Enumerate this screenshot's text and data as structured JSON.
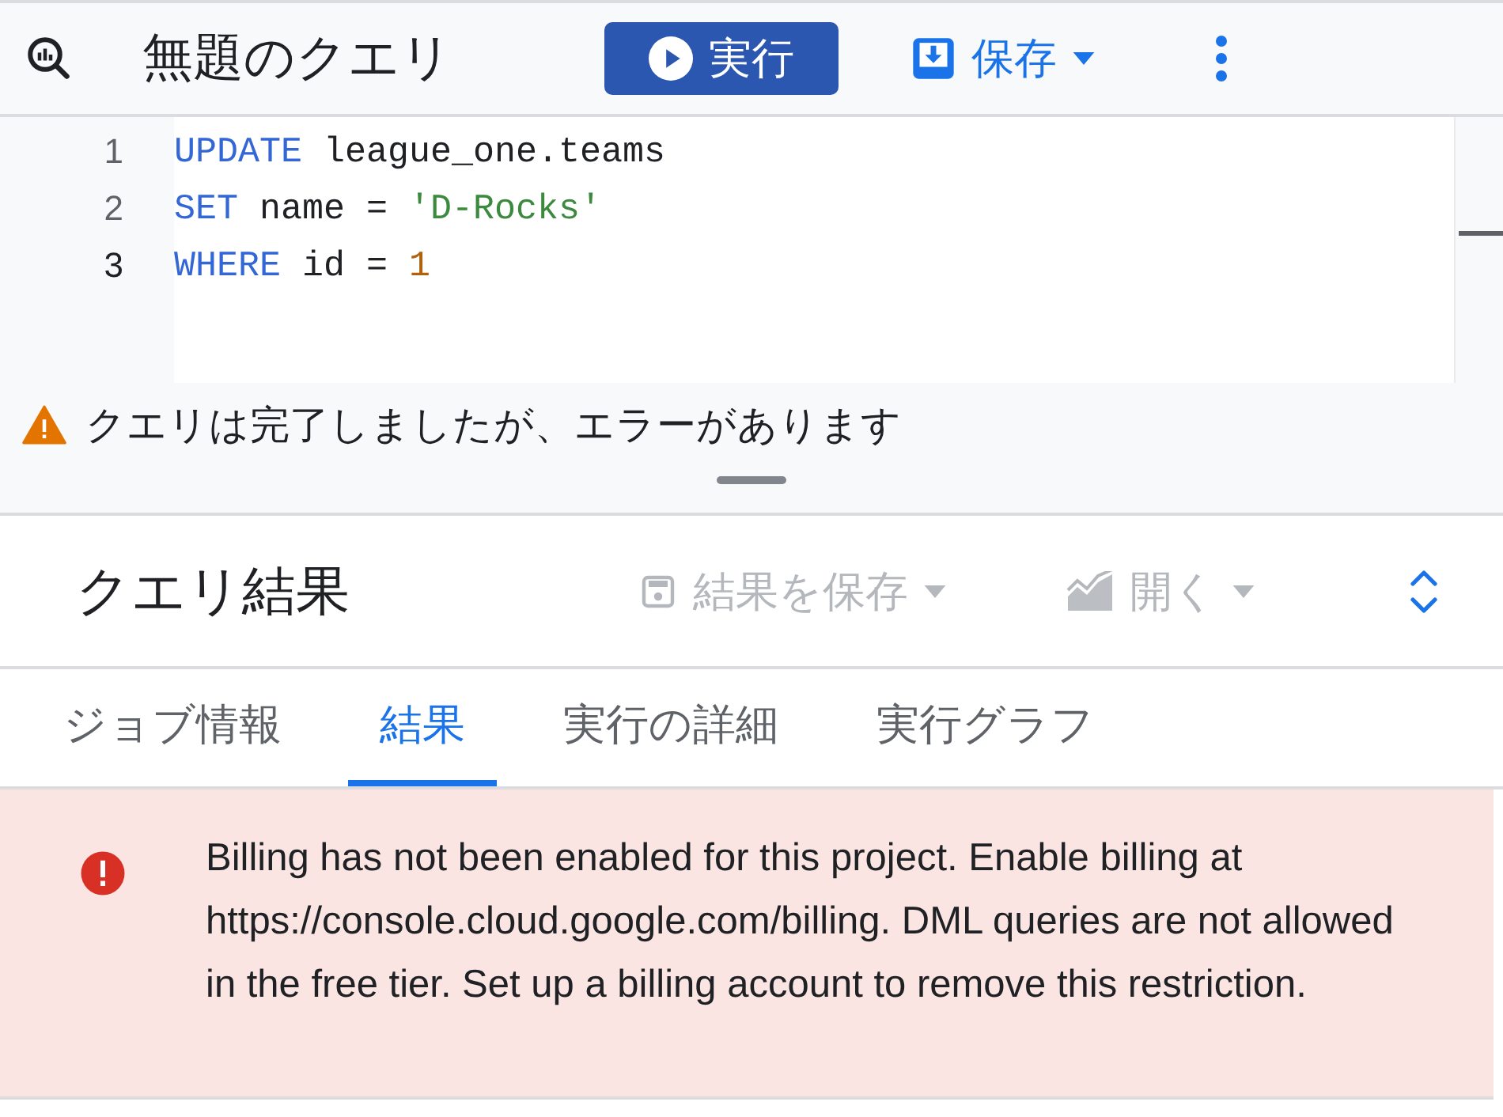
{
  "header": {
    "title": "無題のクエリ",
    "run_button": "実行",
    "save_button": "保存"
  },
  "editor": {
    "lines": [
      {
        "number": "1",
        "current": false,
        "tokens": [
          {
            "kind": "keyword",
            "text": "UPDATE"
          },
          {
            "kind": "plain",
            "text": " league_one.teams"
          }
        ]
      },
      {
        "number": "2",
        "current": false,
        "tokens": [
          {
            "kind": "keyword",
            "text": "SET"
          },
          {
            "kind": "plain",
            "text": " name = "
          },
          {
            "kind": "string",
            "text": "'D-Rocks'"
          }
        ]
      },
      {
        "number": "3",
        "current": true,
        "tokens": [
          {
            "kind": "keyword",
            "text": "WHERE"
          },
          {
            "kind": "plain",
            "text": " id = "
          },
          {
            "kind": "number",
            "text": "1"
          }
        ]
      }
    ]
  },
  "status": {
    "message": "クエリは完了しましたが、エラーがあります"
  },
  "results": {
    "title": "クエリ結果",
    "save_results_button": {
      "label": "結果を保存",
      "disabled": true
    },
    "open_button": {
      "label": "開く",
      "disabled": true
    },
    "tabs": [
      {
        "label": "ジョブ情報",
        "selected": false
      },
      {
        "label": "結果",
        "selected": true
      },
      {
        "label": "実行の詳細",
        "selected": false
      },
      {
        "label": "実行グラフ",
        "selected": false
      }
    ],
    "error": "Billing has not been enabled for this project. Enable billing at https://console.cloud.google.com/billing. DML queries are not allowed in the free tier. Set up a billing account to remove this restriction."
  }
}
